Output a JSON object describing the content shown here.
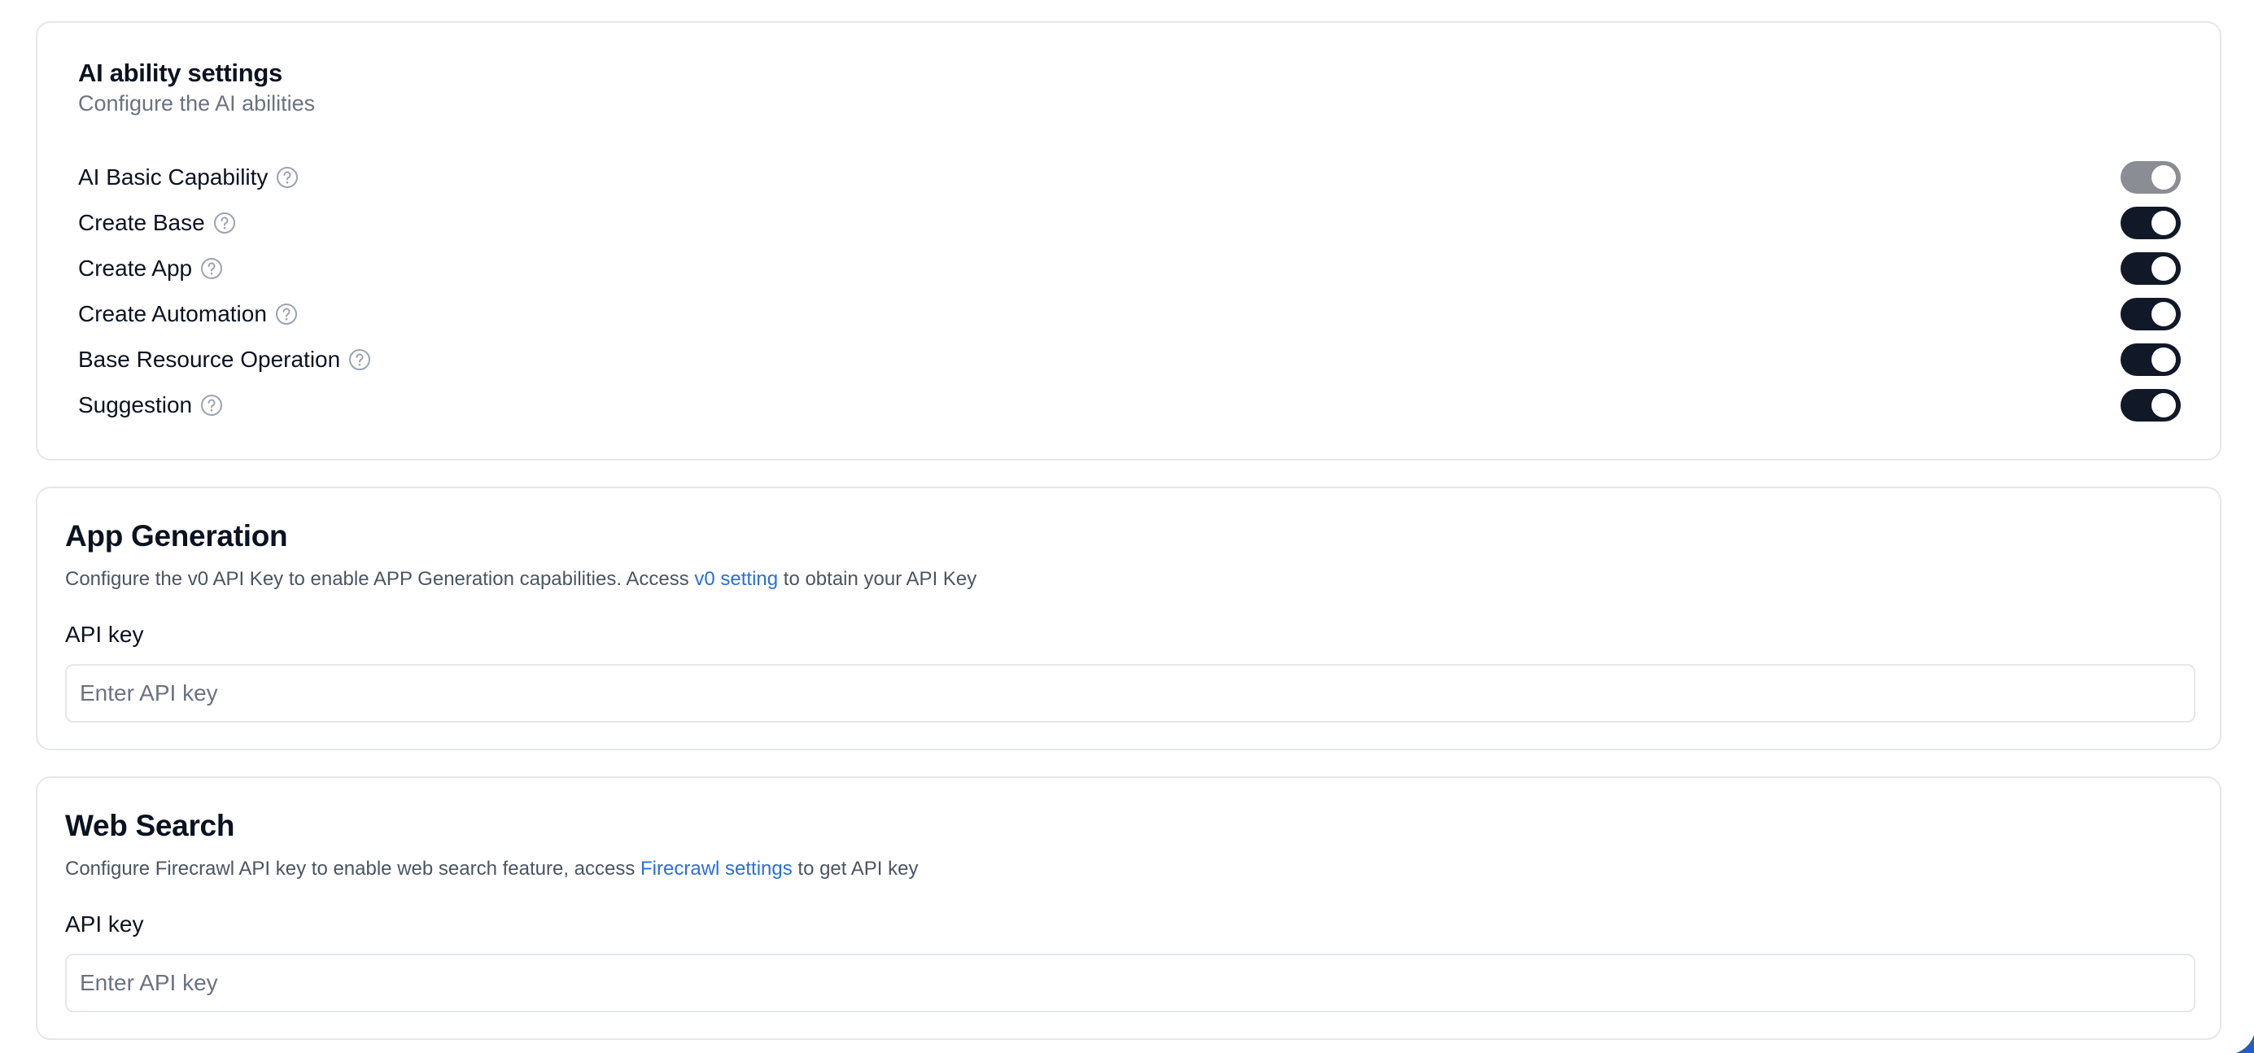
{
  "ai_settings": {
    "title": "AI ability settings",
    "subtitle": "Configure the AI abilities",
    "items": [
      {
        "label": "AI Basic Capability",
        "enabled": true,
        "disabled": true
      },
      {
        "label": "Create Base",
        "enabled": true,
        "disabled": false
      },
      {
        "label": "Create App",
        "enabled": true,
        "disabled": false
      },
      {
        "label": "Create Automation",
        "enabled": true,
        "disabled": false
      },
      {
        "label": "Base Resource Operation",
        "enabled": true,
        "disabled": false
      },
      {
        "label": "Suggestion",
        "enabled": true,
        "disabled": false
      }
    ]
  },
  "app_generation": {
    "title": "App Generation",
    "desc_before": "Configure the v0 API Key to enable APP Generation capabilities. Access ",
    "link_text": "v0 setting",
    "desc_after": " to obtain your API Key",
    "field_label": "API key",
    "input_value": "",
    "placeholder": "Enter API key"
  },
  "web_search": {
    "title": "Web Search",
    "desc_before": "Configure Firecrawl API key to enable web search feature, access ",
    "link_text": "Firecrawl settings",
    "desc_after": " to get API key",
    "field_label": "API key",
    "input_value": "",
    "placeholder": "Enter API key"
  },
  "colors": {
    "toggle_on": "#111827",
    "toggle_disabled": "#8a8d93",
    "link": "#2b6fd6",
    "corner_accent": "#1f5fbf"
  }
}
